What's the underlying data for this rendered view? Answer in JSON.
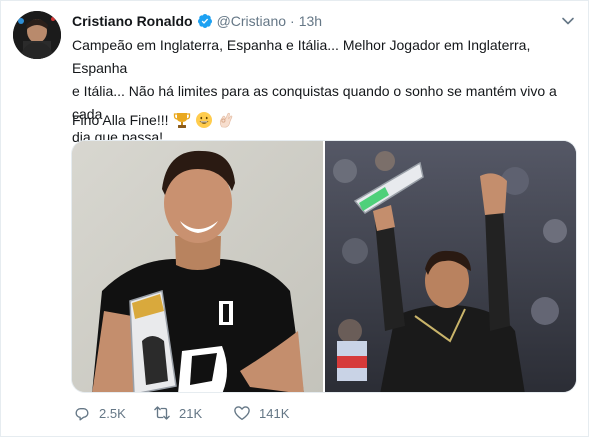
{
  "author": {
    "name": "Cristiano Ronaldo",
    "handle": "@Cristiano",
    "time": "13h",
    "verified": true
  },
  "tweet": {
    "text": "Campeão em Inglaterra, Espanha e Itália... Melhor Jogador em Inglaterra, Espanha\ne Itália... Não há limites para as conquistas quando o sonho se mantém vivo a cada\ndia que passa!",
    "signoff": "Fino Alla Fine!!!",
    "emojis": [
      "trophy-emoji",
      "grinning-face-emoji",
      "ok-hand-emoji"
    ]
  },
  "actions": {
    "replies": "2.5K",
    "retweets": "21K",
    "likes": "141K"
  },
  "colors": {
    "text": "#14171a",
    "muted": "#657786",
    "verified": "#1da1f2",
    "border": "#e6ecf0"
  }
}
